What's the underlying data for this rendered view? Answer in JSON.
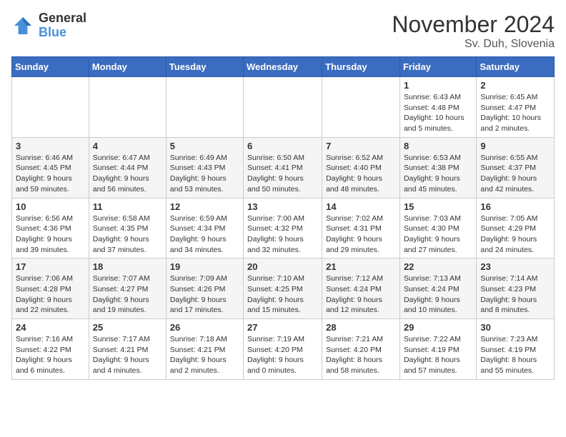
{
  "header": {
    "logo_general": "General",
    "logo_blue": "Blue",
    "month_title": "November 2024",
    "location": "Sv. Duh, Slovenia"
  },
  "weekdays": [
    "Sunday",
    "Monday",
    "Tuesday",
    "Wednesday",
    "Thursday",
    "Friday",
    "Saturday"
  ],
  "weeks": [
    [
      {
        "day": "",
        "info": ""
      },
      {
        "day": "",
        "info": ""
      },
      {
        "day": "",
        "info": ""
      },
      {
        "day": "",
        "info": ""
      },
      {
        "day": "",
        "info": ""
      },
      {
        "day": "1",
        "info": "Sunrise: 6:43 AM\nSunset: 4:48 PM\nDaylight: 10 hours and 5 minutes."
      },
      {
        "day": "2",
        "info": "Sunrise: 6:45 AM\nSunset: 4:47 PM\nDaylight: 10 hours and 2 minutes."
      }
    ],
    [
      {
        "day": "3",
        "info": "Sunrise: 6:46 AM\nSunset: 4:45 PM\nDaylight: 9 hours and 59 minutes."
      },
      {
        "day": "4",
        "info": "Sunrise: 6:47 AM\nSunset: 4:44 PM\nDaylight: 9 hours and 56 minutes."
      },
      {
        "day": "5",
        "info": "Sunrise: 6:49 AM\nSunset: 4:43 PM\nDaylight: 9 hours and 53 minutes."
      },
      {
        "day": "6",
        "info": "Sunrise: 6:50 AM\nSunset: 4:41 PM\nDaylight: 9 hours and 50 minutes."
      },
      {
        "day": "7",
        "info": "Sunrise: 6:52 AM\nSunset: 4:40 PM\nDaylight: 9 hours and 48 minutes."
      },
      {
        "day": "8",
        "info": "Sunrise: 6:53 AM\nSunset: 4:38 PM\nDaylight: 9 hours and 45 minutes."
      },
      {
        "day": "9",
        "info": "Sunrise: 6:55 AM\nSunset: 4:37 PM\nDaylight: 9 hours and 42 minutes."
      }
    ],
    [
      {
        "day": "10",
        "info": "Sunrise: 6:56 AM\nSunset: 4:36 PM\nDaylight: 9 hours and 39 minutes."
      },
      {
        "day": "11",
        "info": "Sunrise: 6:58 AM\nSunset: 4:35 PM\nDaylight: 9 hours and 37 minutes."
      },
      {
        "day": "12",
        "info": "Sunrise: 6:59 AM\nSunset: 4:34 PM\nDaylight: 9 hours and 34 minutes."
      },
      {
        "day": "13",
        "info": "Sunrise: 7:00 AM\nSunset: 4:32 PM\nDaylight: 9 hours and 32 minutes."
      },
      {
        "day": "14",
        "info": "Sunrise: 7:02 AM\nSunset: 4:31 PM\nDaylight: 9 hours and 29 minutes."
      },
      {
        "day": "15",
        "info": "Sunrise: 7:03 AM\nSunset: 4:30 PM\nDaylight: 9 hours and 27 minutes."
      },
      {
        "day": "16",
        "info": "Sunrise: 7:05 AM\nSunset: 4:29 PM\nDaylight: 9 hours and 24 minutes."
      }
    ],
    [
      {
        "day": "17",
        "info": "Sunrise: 7:06 AM\nSunset: 4:28 PM\nDaylight: 9 hours and 22 minutes."
      },
      {
        "day": "18",
        "info": "Sunrise: 7:07 AM\nSunset: 4:27 PM\nDaylight: 9 hours and 19 minutes."
      },
      {
        "day": "19",
        "info": "Sunrise: 7:09 AM\nSunset: 4:26 PM\nDaylight: 9 hours and 17 minutes."
      },
      {
        "day": "20",
        "info": "Sunrise: 7:10 AM\nSunset: 4:25 PM\nDaylight: 9 hours and 15 minutes."
      },
      {
        "day": "21",
        "info": "Sunrise: 7:12 AM\nSunset: 4:24 PM\nDaylight: 9 hours and 12 minutes."
      },
      {
        "day": "22",
        "info": "Sunrise: 7:13 AM\nSunset: 4:24 PM\nDaylight: 9 hours and 10 minutes."
      },
      {
        "day": "23",
        "info": "Sunrise: 7:14 AM\nSunset: 4:23 PM\nDaylight: 9 hours and 8 minutes."
      }
    ],
    [
      {
        "day": "24",
        "info": "Sunrise: 7:16 AM\nSunset: 4:22 PM\nDaylight: 9 hours and 6 minutes."
      },
      {
        "day": "25",
        "info": "Sunrise: 7:17 AM\nSunset: 4:21 PM\nDaylight: 9 hours and 4 minutes."
      },
      {
        "day": "26",
        "info": "Sunrise: 7:18 AM\nSunset: 4:21 PM\nDaylight: 9 hours and 2 minutes."
      },
      {
        "day": "27",
        "info": "Sunrise: 7:19 AM\nSunset: 4:20 PM\nDaylight: 9 hours and 0 minutes."
      },
      {
        "day": "28",
        "info": "Sunrise: 7:21 AM\nSunset: 4:20 PM\nDaylight: 8 hours and 58 minutes."
      },
      {
        "day": "29",
        "info": "Sunrise: 7:22 AM\nSunset: 4:19 PM\nDaylight: 8 hours and 57 minutes."
      },
      {
        "day": "30",
        "info": "Sunrise: 7:23 AM\nSunset: 4:19 PM\nDaylight: 8 hours and 55 minutes."
      }
    ]
  ]
}
